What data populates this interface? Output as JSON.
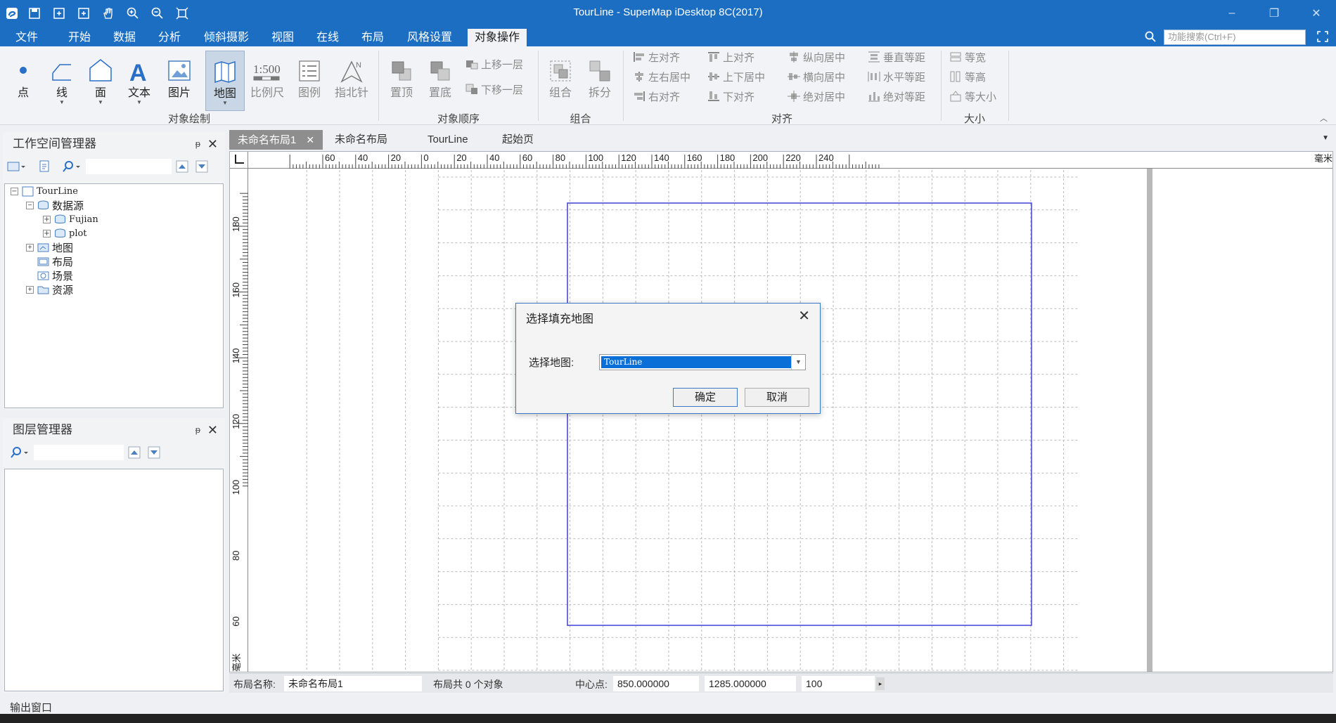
{
  "app_title": "TourLine - SuperMap iDesktop 8C(2017)",
  "quick_access": [
    "app-logo-icon",
    "save-icon",
    "save-as-icon",
    "new-layout-icon",
    "pan-hand-icon",
    "zoom-in-icon",
    "zoom-out-icon",
    "full-extent-icon"
  ],
  "menu": [
    "文件",
    "开始",
    "数据",
    "分析",
    "倾斜摄影",
    "视图",
    "在线",
    "布局",
    "风格设置",
    "对象操作"
  ],
  "menu_active": "对象操作",
  "search_placeholder": "功能搜索(Ctrl+F)",
  "ribbon": {
    "draw_buttons": [
      "点",
      "线",
      "面",
      "文本",
      "图片",
      "地图",
      "比例尺",
      "图例",
      "指北针"
    ],
    "scale_bar_text": "1:500",
    "order_big": [
      "置顶",
      "置底"
    ],
    "order_small": [
      "上移一层",
      "下移一层"
    ],
    "group_buttons": [
      "组合",
      "拆分"
    ],
    "align_col1": [
      "左对齐",
      "左右居中",
      "右对齐"
    ],
    "align_col2": [
      "上对齐",
      "上下居中",
      "下对齐"
    ],
    "align_col3": [
      "纵向居中",
      "横向居中",
      "绝对居中"
    ],
    "align_col4": [
      "垂直等距",
      "水平等距",
      "绝对等距"
    ],
    "size_col": [
      "等宽",
      "等高",
      "等大小"
    ],
    "group_labels": [
      "对象绘制",
      "对象顺序",
      "组合",
      "对齐",
      "大小"
    ]
  },
  "workspace_panel": {
    "title": "工作空间管理器",
    "pin": "ᵽ",
    "tree": [
      {
        "label": "TourLine",
        "level": 0,
        "exp": "−"
      },
      {
        "label": "数据源",
        "level": 1,
        "exp": "−"
      },
      {
        "label": "Fujian",
        "level": 2,
        "exp": "+"
      },
      {
        "label": "plot",
        "level": 2,
        "exp": "+"
      },
      {
        "label": "地图",
        "level": 1,
        "exp": "+"
      },
      {
        "label": "布局",
        "level": 1,
        "exp": ""
      },
      {
        "label": "场景",
        "level": 1,
        "exp": ""
      },
      {
        "label": "资源",
        "level": 1,
        "exp": "+"
      }
    ]
  },
  "layer_panel": {
    "title": "图层管理器"
  },
  "doc_tabs": [
    "未命名布局1",
    "未命名布局",
    "TourLine",
    "起始页"
  ],
  "ruler": {
    "h_labels": [
      "60",
      "40",
      "20",
      "0",
      "20",
      "40",
      "60",
      "80",
      "100",
      "120",
      "140",
      "160",
      "180",
      "200",
      "220",
      "240"
    ],
    "unit": "毫米",
    "v_labels": [
      "180",
      "160",
      "140",
      "120",
      "100",
      "80",
      "60"
    ],
    "v_unit": "毫米"
  },
  "status": {
    "name_label": "布局名称:",
    "name_value": "未命名布局1",
    "count_text": "布局共 0 个对象",
    "center_label": "中心点:",
    "center_x": "850.000000",
    "center_y": "1285.000000",
    "scale": "100"
  },
  "output_window": "输出窗口",
  "dialog": {
    "title": "选择填充地图",
    "label": "选择地图:",
    "selected_map": "TourLine",
    "ok": "确定",
    "cancel": "取消"
  },
  "colors": {
    "titlebar": "#1b6ec2",
    "layout_frame": "#4b4bd6",
    "selection": "#0a6fd6"
  }
}
